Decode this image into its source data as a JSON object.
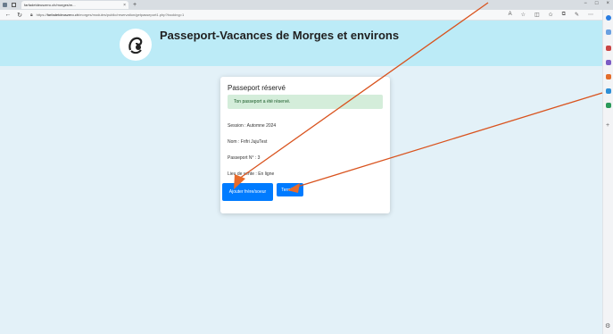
{
  "browser": {
    "tab_title": "farfadetdeuszero.ch/morges/m...",
    "tab_close": "×",
    "new_tab": "+",
    "window_controls": [
      "−",
      "□",
      "×"
    ],
    "url_prefix": "https://",
    "url_host": "farfadetdeuszero.ch",
    "url_path": "/morges/modules/public/reservation/getpasseport1.php?booking=1"
  },
  "site": {
    "title": "Passeport-Vacances de Morges et environs"
  },
  "card": {
    "title": "Passeport réservé",
    "alert": "Ton passeport a été réservé.",
    "lines": {
      "session": "Session : Automne 2024",
      "name": "Nom : Frifri JujuTest",
      "passport_no": "Passeport N° : 3",
      "sale_place": "Lieu de vente : En ligne"
    },
    "add_sibling_label": "Ajouter frère/soeur",
    "finish_label": "Terminer"
  },
  "colors": {
    "header_bg": "#bcebf7",
    "page_bg": "#e3f1f8",
    "button": "#007bff",
    "alert_bg": "#d4edda",
    "arrow": "#d9531e"
  },
  "icons": [
    "back-icon",
    "refresh-icon",
    "lock-icon",
    "read-aloud-icon",
    "favorite-icon",
    "split-screen-icon",
    "favorites-bar-icon",
    "collections-icon",
    "extensions-icon",
    "more-icon"
  ]
}
